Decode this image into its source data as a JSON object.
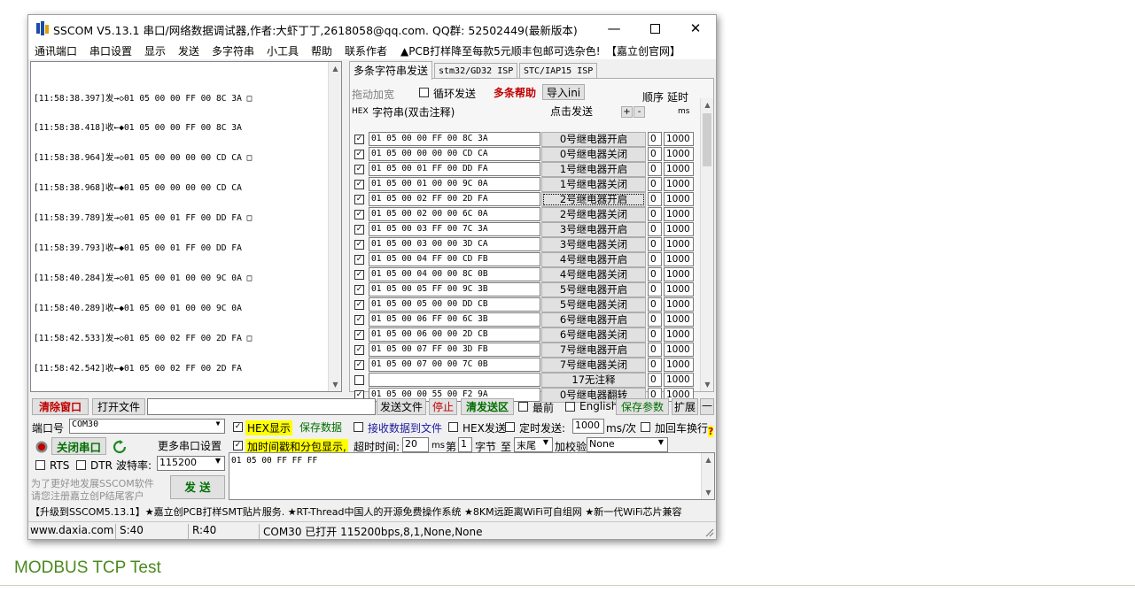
{
  "window": {
    "title": "SSCOM V5.13.1 串口/网络数据调试器,作者:大虾丁丁,2618058@qq.com. QQ群: 52502449(最新版本)"
  },
  "menu": [
    "通讯端口",
    "串口设置",
    "显示",
    "发送",
    "多字符串",
    "小工具",
    "帮助",
    "联系作者",
    "▲PCB打样降至每款5元顺丰包邮可选杂色!",
    "【嘉立创官网】"
  ],
  "receive": {
    "lines": [
      "[11:58:38.397]发→◇01 05 00 00 FF 00 8C 3A □",
      "[11:58:38.418]收←◆01 05 00 00 FF 00 8C 3A",
      "[11:58:38.964]发→◇01 05 00 00 00 00 CD CA □",
      "[11:58:38.968]收←◆01 05 00 00 00 00 CD CA",
      "[11:58:39.789]发→◇01 05 00 01 FF 00 DD FA □",
      "[11:58:39.793]收←◆01 05 00 01 FF 00 DD FA",
      "[11:58:40.284]发→◇01 05 00 01 00 00 9C 0A □",
      "[11:58:40.289]收←◆01 05 00 01 00 00 9C 0A",
      "[11:58:42.533]发→◇01 05 00 02 FF 00 2D FA □",
      "[11:58:42.542]收←◆01 05 00 02 FF 00 2D FA"
    ]
  },
  "tabs": [
    "多条字符串发送",
    "stm32/GD32 ISP",
    "STC/IAP15 ISP"
  ],
  "multi": {
    "drag_label": "拖动加宽",
    "loop_label": "循环发送",
    "help_label": "多条帮助",
    "import_label": "导入ini",
    "order_header": "顺序",
    "delay_header": "延时",
    "hex_header": "HEX",
    "string_header": "字符串(双击注释)",
    "click_header": "点击发送",
    "plus": "+",
    "minus": "-",
    "ms_header": "ms",
    "rows": [
      {
        "checked": true,
        "hex": "01 05 00 00 FF 00 8C 3A",
        "label": "0号继电器开启",
        "order": "0",
        "delay": "1000"
      },
      {
        "checked": true,
        "hex": "01 05 00 00 00 00 CD CA",
        "label": "0号继电器关闭",
        "order": "0",
        "delay": "1000"
      },
      {
        "checked": true,
        "hex": "01 05 00 01 FF 00 DD FA",
        "label": "1号继电器开启",
        "order": "0",
        "delay": "1000"
      },
      {
        "checked": true,
        "hex": "01 05 00 01 00 00 9C 0A",
        "label": "1号继电器关闭",
        "order": "0",
        "delay": "1000"
      },
      {
        "checked": true,
        "hex": "01 05 00 02 FF 00 2D FA",
        "label": "2号继电器开启",
        "order": "0",
        "delay": "1000"
      },
      {
        "checked": true,
        "hex": "01 05 00 02 00 00 6C 0A",
        "label": "2号继电器关闭",
        "order": "0",
        "delay": "1000"
      },
      {
        "checked": true,
        "hex": "01 05 00 03 FF 00 7C 3A",
        "label": "3号继电器开启",
        "order": "0",
        "delay": "1000"
      },
      {
        "checked": true,
        "hex": "01 05 00 03 00 00 3D CA",
        "label": "3号继电器关闭",
        "order": "0",
        "delay": "1000"
      },
      {
        "checked": true,
        "hex": "01 05 00 04 FF 00 CD FB",
        "label": "4号继电器开启",
        "order": "0",
        "delay": "1000"
      },
      {
        "checked": true,
        "hex": "01 05 00 04 00 00 8C 0B",
        "label": "4号继电器关闭",
        "order": "0",
        "delay": "1000"
      },
      {
        "checked": true,
        "hex": "01 05 00 05 FF 00 9C 3B",
        "label": "5号继电器开启",
        "order": "0",
        "delay": "1000"
      },
      {
        "checked": true,
        "hex": "01 05 00 05 00 00 DD CB",
        "label": "5号继电器关闭",
        "order": "0",
        "delay": "1000"
      },
      {
        "checked": true,
        "hex": "01 05 00 06 FF 00 6C 3B",
        "label": "6号继电器开启",
        "order": "0",
        "delay": "1000"
      },
      {
        "checked": true,
        "hex": "01 05 00 06 00 00 2D CB",
        "label": "6号继电器关闭",
        "order": "0",
        "delay": "1000"
      },
      {
        "checked": true,
        "hex": "01 05 00 07 FF 00 3D FB",
        "label": "7号继电器开启",
        "order": "0",
        "delay": "1000"
      },
      {
        "checked": true,
        "hex": "01 05 00 07 00 00 7C 0B",
        "label": "7号继电器关闭",
        "order": "0",
        "delay": "1000"
      },
      {
        "checked": false,
        "hex": "",
        "label": "17无注释",
        "order": "0",
        "delay": "1000"
      },
      {
        "checked": true,
        "hex": "01 05 00 00 55 00 F2 9A",
        "label": "0号继电器翻转",
        "order": "0",
        "delay": "1000"
      }
    ]
  },
  "toolbar": {
    "clear": "清除窗口",
    "open_file": "打开文件",
    "file_path": "",
    "send_file": "发送文件",
    "stop": "停止",
    "clear_send": "清发送区",
    "topmost": "最前",
    "english": "English",
    "save_params": "保存参数",
    "expand": "扩展",
    "dash": "—"
  },
  "port": {
    "port_label": "端口号",
    "port_value": "COM30",
    "close_port": "关闭串口",
    "more_settings": "更多串口设置",
    "rts": "RTS",
    "dtr": "DTR",
    "baud_label": "波特率:",
    "baud_value": "115200",
    "promo1": "为了更好地发展SSCOM软件",
    "promo2": "请您注册嘉立创P结尾客户",
    "send": "发  送"
  },
  "options": {
    "hex_display": "HEX显示",
    "save_data": "保存数据",
    "recv_to_file": "接收数据到文件",
    "hex_send": "HEX发送",
    "timed_send": "定时发送:",
    "interval": "1000",
    "interval_unit": "ms/次",
    "add_crlf": "加回车换行",
    "timestamp": "加时间戳和分包显示,",
    "timeout_label": "超时时间:",
    "timeout_value": "20",
    "ms": "ms",
    "nth": "第",
    "byte_index": "1",
    "byte_label": "字节",
    "to": "至",
    "tail": "末尾",
    "checksum": "加校验",
    "checksum_value": "None",
    "qmark": "?"
  },
  "send_text": "01 05 00 FF FF FF",
  "banner": "【升级到SSCOM5.13.1】★嘉立创PCB打样SMT贴片服务. ★RT-Thread中国人的开源免费操作系统 ★8KM远距离WiFi可自组网 ★新一代WiFi芯片兼容",
  "status": {
    "site": "www.daxia.com",
    "s": "S:40",
    "r": "R:40",
    "port_info": "COM30 已打开  115200bps,8,1,None,None"
  },
  "page_section": "MODBUS TCP Test",
  "colors": {
    "red_label": "#c00000",
    "green_label": "#007000",
    "highlight": "#ffff00",
    "section_green": "#4a8a1e"
  }
}
